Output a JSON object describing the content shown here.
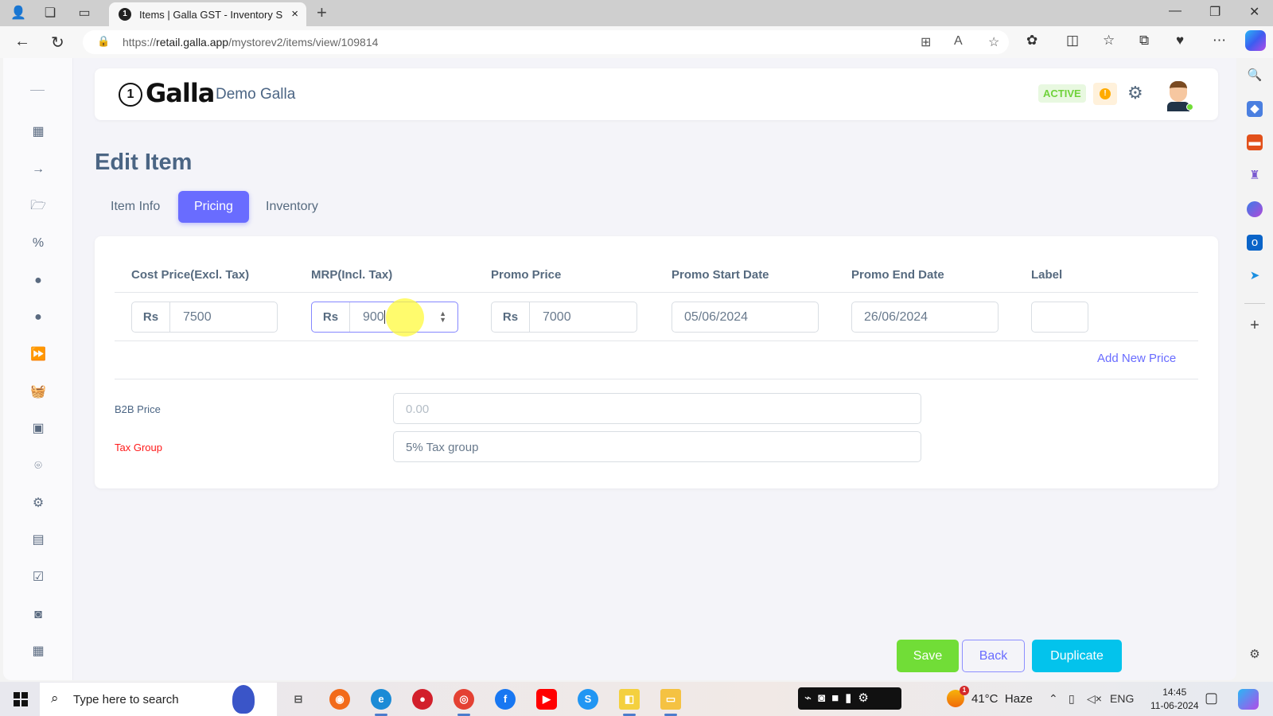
{
  "browser": {
    "tab_title": "Items | Galla GST - Inventory Soft",
    "url_prefix": "https://",
    "url_domain": "retail.galla.app",
    "url_path": "/mystorev2/items/view/109814",
    "icons": {
      "profile": "profile-icon",
      "workspaces": "workspaces-icon",
      "tab_actions": "tab-actions-icon",
      "close": "×",
      "new_tab": "+",
      "back": "←",
      "refresh": "↻",
      "lock": "🔒",
      "minimize": "—",
      "maximize": "❐",
      "close_window": "✕",
      "more": "⋯"
    }
  },
  "app": {
    "logo_text": "Galla",
    "logo_badge": "1",
    "store_name": "Demo Galla",
    "status": "ACTIVE",
    "alert_glyph": "!",
    "colors": {
      "primary": "#696cff",
      "success": "#71dd37",
      "info": "#03c3ec",
      "required": "#ff1a1a",
      "text": "#566a7f"
    }
  },
  "sidebar": {
    "items": [
      {
        "icon": "dashboard-icon",
        "glyph": "▦"
      },
      {
        "icon": "arrow-right-icon",
        "glyph": "→"
      },
      {
        "icon": "folder-open-icon",
        "glyph": "🗁"
      },
      {
        "icon": "discount-ticket-icon",
        "glyph": "%"
      },
      {
        "icon": "user-circle-icon",
        "glyph": "●"
      },
      {
        "icon": "user-circle-icon-2",
        "glyph": "●"
      },
      {
        "icon": "fast-forward-icon",
        "glyph": "⏩"
      },
      {
        "icon": "basket-icon",
        "glyph": "🧺"
      },
      {
        "icon": "contacts-book-icon",
        "glyph": "▣"
      },
      {
        "icon": "location-pin-icon",
        "glyph": "⌾"
      },
      {
        "icon": "settings-icon",
        "glyph": "⚙"
      },
      {
        "icon": "report-file-icon",
        "glyph": "▤"
      },
      {
        "icon": "checkbox-icon",
        "glyph": "☑"
      },
      {
        "icon": "cash-icon",
        "glyph": "◙"
      },
      {
        "icon": "calendar-icon",
        "glyph": "▦"
      }
    ]
  },
  "main": {
    "title": "Edit Item",
    "tabs": [
      {
        "label": "Item Info",
        "active": false
      },
      {
        "label": "Pricing",
        "active": true
      },
      {
        "label": "Inventory",
        "active": false
      }
    ],
    "pricing": {
      "columns": [
        "Cost Price(Excl. Tax)",
        "MRP(Incl. Tax)",
        "Promo Price",
        "Promo Start Date",
        "Promo End Date",
        "Label"
      ],
      "currency_prefix": "Rs",
      "row": {
        "cost_price": "7500",
        "mrp": "900",
        "promo_price": "7000",
        "promo_start": "05/06/2024",
        "promo_end": "26/06/2024",
        "label": ""
      },
      "add_new_price": "Add New Price"
    },
    "b2b_price": {
      "label": "B2B Price",
      "value": "",
      "placeholder": "0.00"
    },
    "tax_group": {
      "label": "Tax Group",
      "value": "5% Tax group"
    },
    "buttons": {
      "save": "Save",
      "back": "Back",
      "duplicate": "Duplicate"
    }
  },
  "edge_sidebar": {
    "items": [
      "search-icon",
      "shopping-tag-icon",
      "toolbox-icon",
      "games-icon",
      "microsoft365-icon",
      "outlook-icon",
      "telegram-icon"
    ],
    "add": "+"
  },
  "taskbar": {
    "search_placeholder": "Type here to search",
    "weather_temp": "41°C",
    "weather_desc": "Haze",
    "weather_badge": "1",
    "language": "ENG",
    "time": "14:45",
    "date": "11-06-2024"
  }
}
